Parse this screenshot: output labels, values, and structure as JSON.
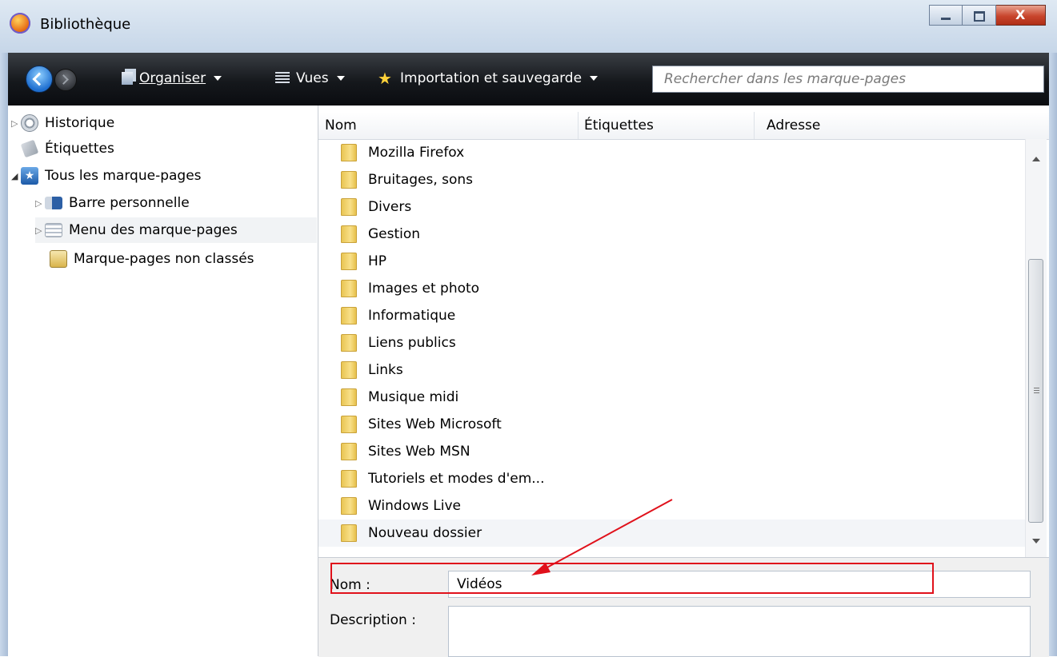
{
  "window": {
    "title": "Bibliothèque"
  },
  "toolbar": {
    "organise": "Organiser",
    "views": "Vues",
    "import": "Importation et sauvegarde",
    "search_placeholder": "Rechercher dans les marque-pages"
  },
  "tree": {
    "items": [
      {
        "label": "Historique",
        "icon": "clock-icon",
        "twisty": "▷"
      },
      {
        "label": "Étiquettes",
        "icon": "tag-icon",
        "twisty": ""
      },
      {
        "label": "Tous les marque-pages",
        "icon": "star-bookmarks-icon",
        "twisty": "◢"
      },
      {
        "label": "Barre personnelle",
        "icon": "toolbar-bookmarks-icon",
        "twisty": "▷"
      },
      {
        "label": "Menu des marque-pages",
        "icon": "menu-bookmarks-icon",
        "twisty": "▷"
      },
      {
        "label": "Marque-pages non classés",
        "icon": "unsorted-bookmarks-icon",
        "twisty": ""
      }
    ]
  },
  "list": {
    "columns": [
      "Nom",
      "Étiquettes",
      "Adresse"
    ],
    "rows": [
      "Mozilla Firefox",
      "Bruitages, sons",
      "Divers",
      "Gestion",
      "HP",
      "Images et  photo",
      "Informatique",
      "Liens publics",
      "Links",
      "Musique midi",
      "Sites Web Microsoft",
      "Sites Web MSN",
      "Tutoriels et modes d'em...",
      "Windows Live",
      "Nouveau dossier"
    ]
  },
  "details": {
    "name_label": "Nom :",
    "name_value": "Vidéos",
    "description_label": "Description :"
  },
  "colors": {
    "highlight": "#e0111b",
    "toolbar": "#15181c",
    "folder": "#f1d26b"
  }
}
